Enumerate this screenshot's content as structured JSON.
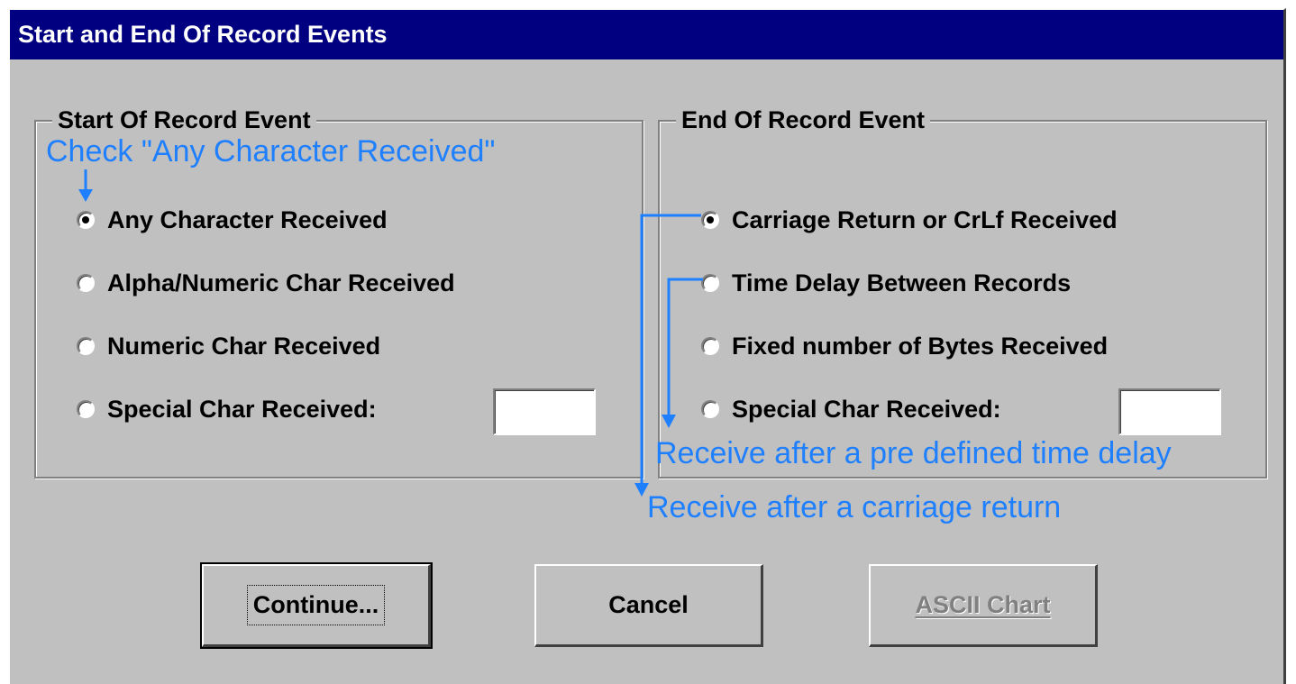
{
  "window": {
    "title": "Start and End Of Record Events"
  },
  "start_group": {
    "legend": "Start Of Record Event",
    "options": [
      {
        "label": "Any Character Received",
        "checked": true
      },
      {
        "label": "Alpha/Numeric Char Received",
        "checked": false
      },
      {
        "label": "Numeric Char Received",
        "checked": false
      },
      {
        "label": "Special Char Received:",
        "checked": false
      }
    ],
    "special_char_value": ""
  },
  "end_group": {
    "legend": "End Of Record Event",
    "options": [
      {
        "label": "Carriage Return or CrLf Received",
        "checked": true
      },
      {
        "label": "Time Delay Between Records",
        "checked": false
      },
      {
        "label": "Fixed number of Bytes Received",
        "checked": false
      },
      {
        "label": "Special Char Received:",
        "checked": false
      }
    ],
    "special_char_value": ""
  },
  "buttons": {
    "continue": "Continue...",
    "cancel": "Cancel",
    "ascii_chart": "ASCII Chart"
  },
  "annotations": {
    "start_hint": "Check \"Any Character Received\"",
    "time_delay_hint": "Receive after a pre defined time delay",
    "carriage_return_hint": "Receive after a carriage return"
  },
  "colors": {
    "titlebar": "#000080",
    "face": "#c0c0c0",
    "annotation": "#1e7fff"
  }
}
